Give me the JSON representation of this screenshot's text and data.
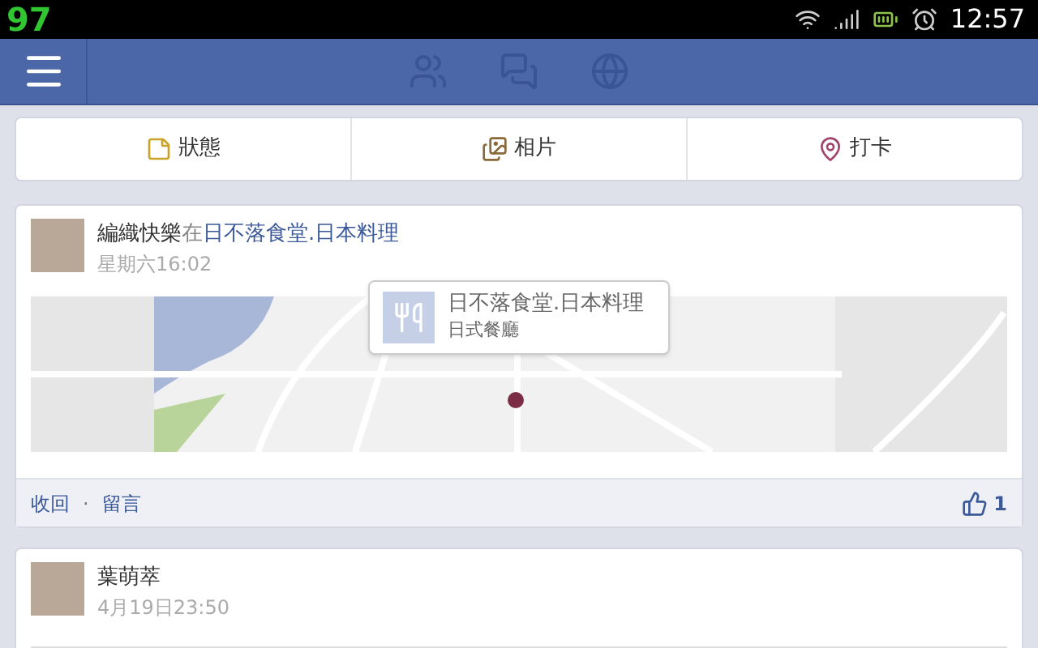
{
  "status_bar": {
    "badge": "97",
    "time": "12:57"
  },
  "composer": [
    {
      "label": "狀態",
      "kind": "status"
    },
    {
      "label": "相片",
      "kind": "photo"
    },
    {
      "label": "打卡",
      "kind": "checkin"
    }
  ],
  "posts": [
    {
      "kind": "map",
      "author": "編織快樂",
      "connector": "在",
      "place": "日不落食堂.日本料理",
      "time": "星期六16:02",
      "map_popup": {
        "title": "日不落食堂.日本料理",
        "subtitle": "日式餐廳"
      },
      "actions": [
        "收回",
        "留言"
      ],
      "separator": "·",
      "likes": "1"
    },
    {
      "kind": "link",
      "author": "葉萌萃",
      "time": "4月19日23:50"
    }
  ]
}
